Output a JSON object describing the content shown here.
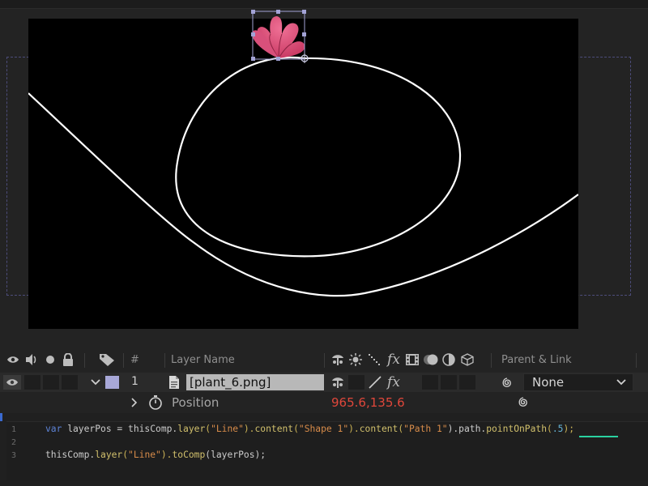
{
  "layer": {
    "number": "1",
    "name": "[plant_6.png]",
    "parent": "None",
    "label_color": "#a8a8d8"
  },
  "timeline_header": {
    "hash_label": "#",
    "layer_name_label": "Layer Name",
    "parent_link_label": "Parent & Link"
  },
  "property": {
    "name": "Position",
    "value_x": "965.6",
    "value_sep": ",",
    "value_y": "135.6"
  },
  "expression": {
    "line_numbers": [
      "1",
      "2",
      "3"
    ],
    "line1": {
      "t1": "var",
      "t2": " layerPos = thisComp.",
      "t3": "layer",
      "t4": "(",
      "t5": "\"Line\"",
      "t6": ").",
      "t7": "content",
      "t8": "(",
      "t9": "\"Shape 1\"",
      "t10": ").",
      "t11": "content",
      "t12": "(",
      "t13": "\"Path 1\"",
      "t14": ").path.",
      "t15": "pointOnPath",
      "t16": "(",
      "t17": ".5",
      "t18": ");"
    },
    "line3": {
      "t1": "thisComp.",
      "t2": "layer",
      "t3": "(",
      "t4": "\"Line\"",
      "t5": ").",
      "t6": "toComp",
      "t7": "(layerPos);"
    }
  },
  "icons": {
    "visibility": "eye-icon",
    "audio": "speaker-icon",
    "solo": "solo-dot-icon",
    "lock": "lock-icon",
    "label": "tag-icon",
    "shy": "shy-icon",
    "collapse": "sun-icon",
    "quality": "quality-slash-icon",
    "effects": "fx-icon",
    "frame_blend": "film-icon",
    "motion_blur": "motion-blur-icon",
    "adjustment": "adjustment-icon",
    "threed": "cube-icon",
    "pickwhip": "spiral-icon",
    "stopwatch": "stopwatch-icon",
    "file": "file-icon"
  },
  "colors": {
    "property_value": "#e0473b",
    "highlight_underline": "#2ad1a0",
    "canvas": "#000000"
  }
}
